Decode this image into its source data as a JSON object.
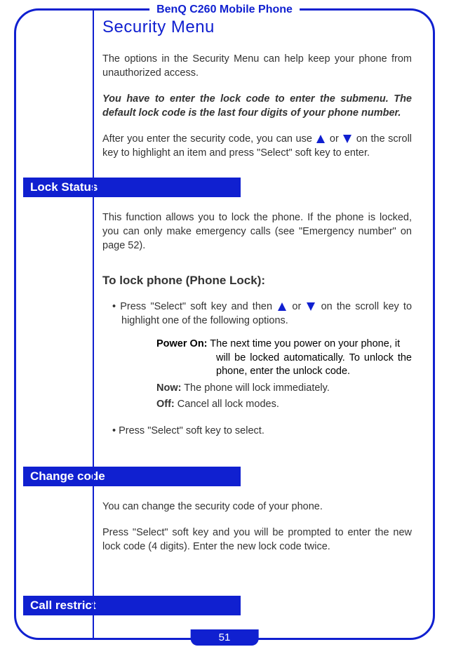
{
  "header": {
    "product_title": "BenQ C260 Mobile Phone"
  },
  "page": {
    "number": "51"
  },
  "main": {
    "title": "Security Menu",
    "intro": "The options in the Security Menu can help keep your phone from unauthorized access.",
    "note": "You have to enter the lock code to enter the submenu. The default lock code is the last four digits of your phone number.",
    "after_code_pre": "After you enter the security code, you can use ",
    "after_code_mid": " or ",
    "after_code_post": " on the scroll key to highlight an item and press \"Select\" soft key to enter."
  },
  "sections": {
    "lock_status": {
      "heading": "Lock Status",
      "desc": "This function allows you to lock the phone. If the phone is locked, you can only make emergency calls (see \"Emergency number\" on page 52).",
      "sub_heading": "To lock phone (Phone Lock):",
      "bullet1_pre": "• Press \"Select\" soft key and then ",
      "bullet1_mid": " or ",
      "bullet1_post": " on the scroll key to highlight one of the following options.",
      "power_on_label": "Power On:",
      "power_on_text1": " The next time you power on your phone, it",
      "power_on_text2": "will be locked automatically. To unlock the phone, enter the unlock code.",
      "now_label": "Now:",
      "now_text": " The phone will lock immediately.",
      "off_label": "Off:",
      "off_text": " Cancel all lock modes.",
      "bullet2": "• Press \"Select\" soft key to select."
    },
    "change_code": {
      "heading": "Change code",
      "desc1": "You can change the security code of your phone.",
      "desc2": "Press \"Select\" soft key and you will be prompted to enter the new lock code (4 digits). Enter the new lock code twice."
    },
    "call_restrict": {
      "heading": "Call restrict"
    }
  }
}
